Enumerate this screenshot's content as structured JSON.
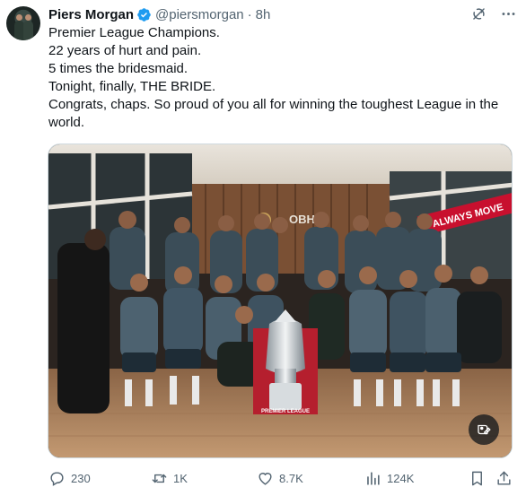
{
  "author": {
    "name": "Piers Morgan",
    "handle": "@piersmorgan",
    "separator": "·",
    "time": "8h"
  },
  "post": {
    "lines": [
      "Premier League Champions.",
      "22 years of hurt and pain.",
      "5 times the bridesmaid.",
      "Tonight, finally, THE BRIDE.",
      "Congrats, chaps. So proud of you all for winning the toughest League in the world."
    ]
  },
  "media": {
    "sign_left": "OBH",
    "sign_right": "ALWAYS MOVE",
    "trophy_banner": "PREMIER LEAGUE"
  },
  "actions": {
    "replies": "230",
    "reposts": "1K",
    "likes": "8.7K",
    "views": "124K"
  },
  "icons": {
    "verified": "verified-badge-icon",
    "grok": "grok-icon",
    "more": "more-icon",
    "reply": "reply-icon",
    "retweet": "retweet-icon",
    "like": "heart-icon",
    "views": "views-icon",
    "bookmark": "bookmark-icon",
    "share": "share-icon"
  },
  "colors": {
    "verified": "#1d9bf0",
    "text": "#0f1419",
    "secondary": "#536471",
    "sign_red": "#c8102e"
  }
}
